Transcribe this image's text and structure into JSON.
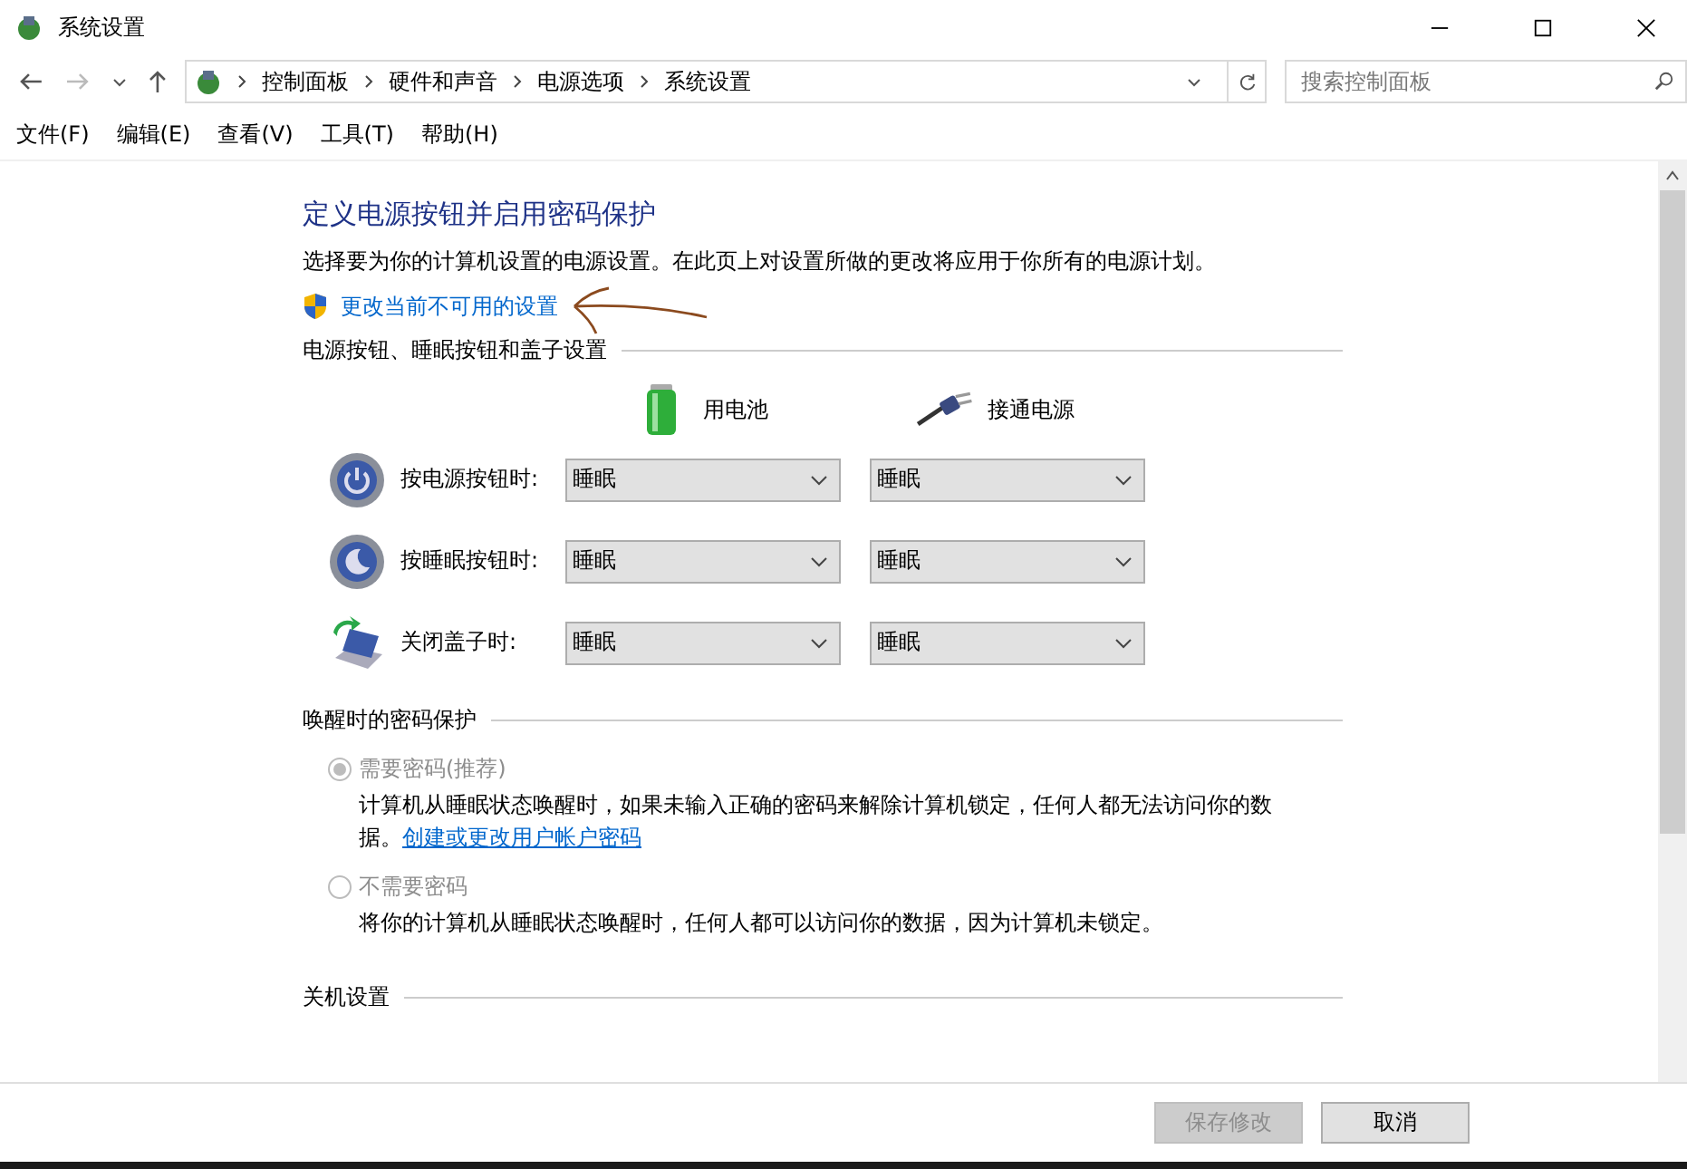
{
  "window": {
    "title": "系统设置"
  },
  "address_bar": {
    "breadcrumbs": [
      "控制面板",
      "硬件和声音",
      "电源选项",
      "系统设置"
    ]
  },
  "search": {
    "placeholder": "搜索控制面板"
  },
  "menu": [
    "文件(F)",
    "编辑(E)",
    "查看(V)",
    "工具(T)",
    "帮助(H)"
  ],
  "heading": "定义电源按钮并启用密码保护",
  "description": "选择要为你的计算机设置的电源设置。在此页上对设置所做的更改将应用于你所有的电源计划。",
  "admin_link": "更改当前不可用的设置",
  "power_section": {
    "title": "电源按钮、睡眠按钮和盖子设置",
    "columns": [
      {
        "label": "用电池",
        "kind": "battery"
      },
      {
        "label": "接通电源",
        "kind": "plug"
      }
    ],
    "rows": [
      {
        "label": "按电源按钮时:",
        "kind": "power",
        "values": [
          "睡眠",
          "睡眠"
        ]
      },
      {
        "label": "按睡眠按钮时:",
        "kind": "sleep",
        "values": [
          "睡眠",
          "睡眠"
        ]
      },
      {
        "label": "关闭盖子时:",
        "kind": "lid",
        "values": [
          "睡眠",
          "睡眠"
        ]
      }
    ]
  },
  "password_section": {
    "title": "唤醒时的密码保护",
    "disabled": true,
    "options": [
      {
        "label": "需要密码(推荐)",
        "selected": true,
        "description": "计算机从睡眠状态唤醒时，如果未输入正确的密码来解除计算机锁定，任何人都无法访问你的数据。",
        "link": "创建或更改用户帐户密码"
      },
      {
        "label": "不需要密码",
        "selected": false,
        "description": "将你的计算机从睡眠状态唤醒时，任何人都可以访问你的数据，因为计算机未锁定。"
      }
    ]
  },
  "shutdown_section": {
    "title": "关机设置"
  },
  "buttons": [
    {
      "label": "保存修改",
      "disabled": true
    },
    {
      "label": "取消",
      "disabled": false
    }
  ]
}
